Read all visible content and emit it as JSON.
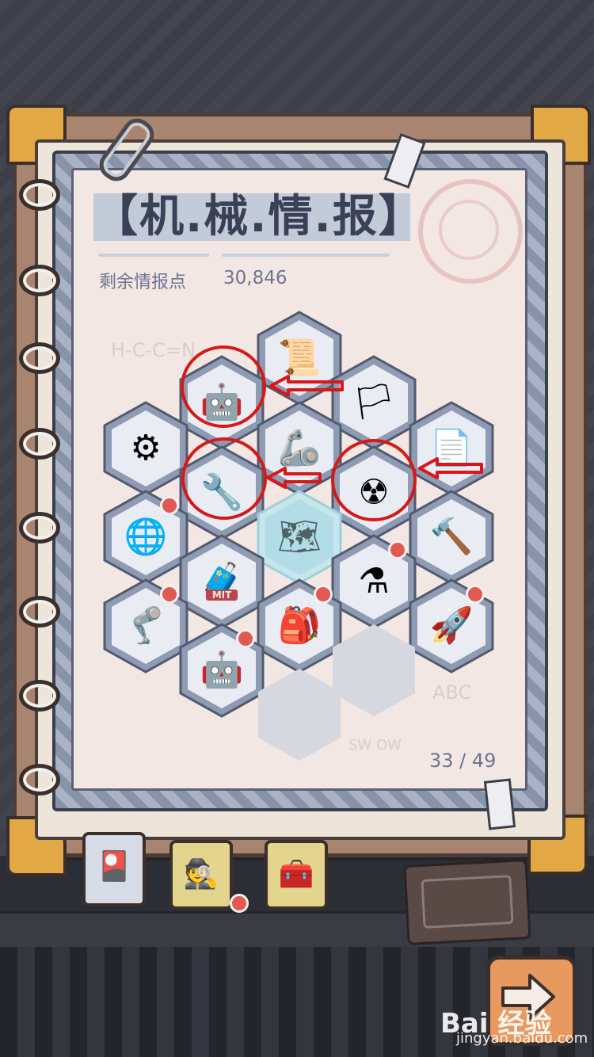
{
  "header": {
    "title": "【机.械.情.报】",
    "points_label": "剩余情报点",
    "points_value": "30,846"
  },
  "progress": "33 / 49",
  "colors": {
    "hex_fill": "#e9ecf3",
    "hex_border": "#8a93ab",
    "hex_outline": "#525a6e",
    "highlight_red": "#d81818",
    "notification": "#e05a52",
    "title_band": "#c3cad8"
  },
  "grid": {
    "hexes": [
      {
        "id": "scroll-map",
        "icon": "scroll-map-icon",
        "glyph": "📜",
        "state": "unlocked",
        "badge": false
      },
      {
        "id": "robot-head",
        "icon": "robot-head-icon",
        "glyph": "🤖",
        "state": "unlocked",
        "badge": false,
        "circled": true
      },
      {
        "id": "flag",
        "icon": "flag-icon",
        "glyph": "🏳",
        "state": "unlocked",
        "badge": false
      },
      {
        "id": "spinning-wheel",
        "icon": "spinning-wheel-icon",
        "glyph": "⚙",
        "state": "unlocked",
        "badge": false
      },
      {
        "id": "robot-arm",
        "icon": "robot-arm-icon",
        "glyph": "🦾",
        "state": "unlocked",
        "badge": false
      },
      {
        "id": "documents",
        "icon": "documents-icon",
        "glyph": "📄",
        "state": "unlocked",
        "badge": false
      },
      {
        "id": "wrench-card",
        "icon": "wrench-card-icon",
        "glyph": "🔧",
        "state": "unlocked",
        "badge": false,
        "circled": true
      },
      {
        "id": "radiation-sign",
        "icon": "radiation-sign-icon",
        "glyph": "☢",
        "state": "unlocked",
        "badge": false,
        "circled": true
      },
      {
        "id": "globe-scribble",
        "icon": "globe-icon",
        "glyph": "🌐",
        "state": "unlocked",
        "badge": true
      },
      {
        "id": "blueprint",
        "icon": "blueprint-icon",
        "glyph": "🗺",
        "state": "selected",
        "badge": false
      },
      {
        "id": "drill-hand",
        "icon": "drill-hand-icon",
        "glyph": "🔨",
        "state": "unlocked",
        "badge": false
      },
      {
        "id": "mit-case",
        "icon": "mit-case-icon",
        "glyph": "🧳",
        "state": "unlocked",
        "badge": false,
        "label": "MIT"
      },
      {
        "id": "machine",
        "icon": "machine-icon",
        "glyph": "⚗",
        "state": "unlocked",
        "badge": true
      },
      {
        "id": "mech-suit",
        "icon": "mech-suit-icon",
        "glyph": "🦿",
        "state": "unlocked",
        "badge": true
      },
      {
        "id": "tied-bag",
        "icon": "tied-bag-icon",
        "glyph": "🎒",
        "state": "unlocked",
        "badge": true
      },
      {
        "id": "rocket",
        "icon": "rocket-icon",
        "glyph": "🚀",
        "state": "unlocked",
        "badge": true
      },
      {
        "id": "tank-robot",
        "icon": "tank-robot-icon",
        "glyph": "🤖",
        "state": "unlocked",
        "badge": true
      },
      {
        "id": "locked-1",
        "icon": "empty-hex",
        "glyph": "",
        "state": "locked",
        "badge": false
      },
      {
        "id": "locked-2",
        "icon": "empty-hex",
        "glyph": "",
        "state": "locked",
        "badge": false
      }
    ]
  },
  "tabs": [
    {
      "id": "intel-cards",
      "icon": "intel-card-icon",
      "glyph": "🎴",
      "active": true
    },
    {
      "id": "agent",
      "icon": "agent-hat-icon",
      "glyph": "🕵",
      "active": false,
      "badge": true
    },
    {
      "id": "chest",
      "icon": "chained-chest-icon",
      "glyph": "🧰",
      "active": false
    }
  ],
  "next_button": {
    "icon": "arrow-right-icon"
  },
  "watermark": {
    "line1": "Bai 经验",
    "line2": "jingyan.baidu.com"
  },
  "sketches": {
    "formula": "H-C-C=N",
    "abc": "ABC",
    "swow": "SW OW"
  }
}
